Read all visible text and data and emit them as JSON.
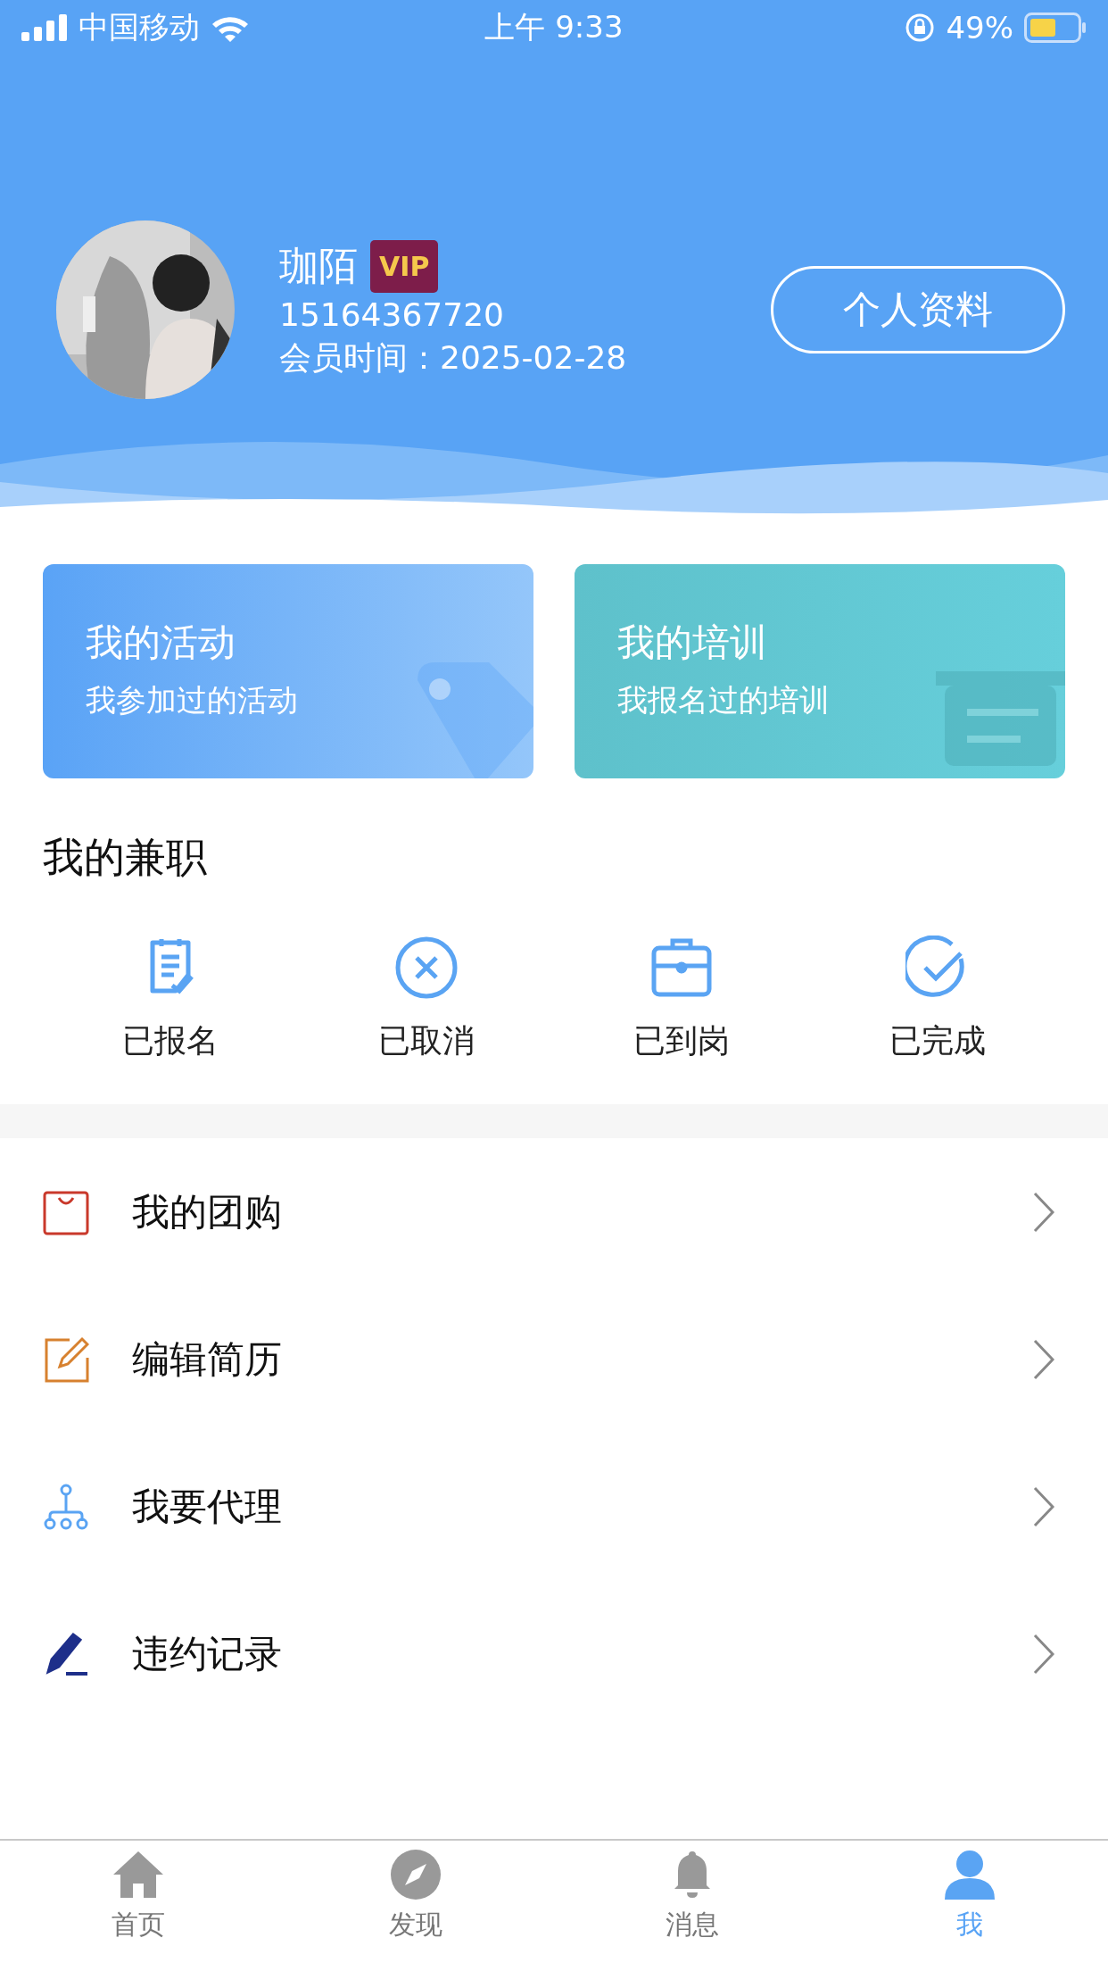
{
  "status_bar": {
    "carrier": "中国移动",
    "time": "上午 9:33",
    "battery": "49%"
  },
  "profile": {
    "name": "珈陌",
    "badge": "VIP",
    "phone": "15164367720",
    "membership": "会员时间：2025-02-28",
    "button": "个人资料"
  },
  "cards": [
    {
      "kind": "activity",
      "title": "我的活动",
      "subtitle": "我参加过的活动"
    },
    {
      "kind": "training",
      "title": "我的培训",
      "subtitle": "我报名过的培训"
    }
  ],
  "part_time": {
    "title": "我的兼职",
    "items": [
      {
        "kind": "signed",
        "label": "已报名"
      },
      {
        "kind": "cancelled",
        "label": "已取消"
      },
      {
        "kind": "arrived",
        "label": "已到岗"
      },
      {
        "kind": "done",
        "label": "已完成"
      }
    ]
  },
  "menu": [
    {
      "kind": "bag",
      "label": "我的团购",
      "color": "#c9392b"
    },
    {
      "kind": "edit",
      "label": "编辑简历",
      "color": "#d7812f"
    },
    {
      "kind": "tree",
      "label": "我要代理",
      "color": "#5aa4f3"
    },
    {
      "kind": "pen",
      "label": "违约记录",
      "color": "#1e2f8a"
    }
  ],
  "tab_bar": [
    {
      "kind": "home",
      "label": "首页",
      "selected": false
    },
    {
      "kind": "discover",
      "label": "发现",
      "selected": false
    },
    {
      "kind": "bell",
      "label": "消息",
      "selected": false
    },
    {
      "kind": "me",
      "label": "我",
      "selected": true
    }
  ]
}
